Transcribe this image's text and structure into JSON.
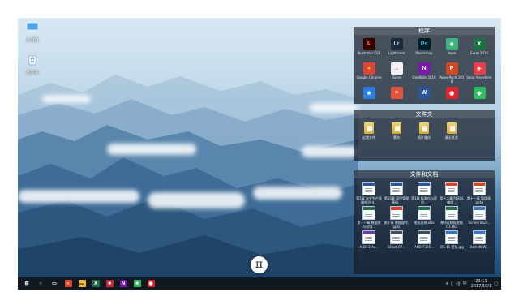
{
  "desktop_icons": [
    {
      "label": "此电脑",
      "icon": "computer-icon"
    },
    {
      "label": "回收站",
      "icon": "recycle-bin-icon"
    }
  ],
  "panels": {
    "programs": {
      "title": "程序",
      "items": [
        {
          "label": "Illustrator CS6",
          "glyph": "Ai",
          "color": "#ff7c00",
          "bg": "#330000"
        },
        {
          "label": "Lightroom",
          "glyph": "Lr",
          "color": "#b9d7f3",
          "bg": "#1c2b3c"
        },
        {
          "label": "Photoshop",
          "glyph": "Ps",
          "color": "#31c5f0",
          "bg": "#001d26"
        },
        {
          "label": "Atom",
          "glyph": "⚛",
          "color": "#ffffff",
          "bg": "#3fb27f"
        },
        {
          "label": "Excel 2016",
          "glyph": "X",
          "color": "#ffffff",
          "bg": "#1e7145"
        },
        {
          "label": "Google Chrome",
          "glyph": "●",
          "color": "#fbc02d",
          "bg": "#db4437"
        },
        {
          "label": "iTunes",
          "glyph": "♫",
          "color": "#e9458b",
          "bg": "#f2f2f2"
        },
        {
          "label": "OneNote 2016",
          "glyph": "N",
          "color": "#ffffff",
          "bg": "#7719aa"
        },
        {
          "label": "PowerPoint 2016",
          "glyph": "P",
          "color": "#ffffff",
          "bg": "#d24726"
        },
        {
          "label": "Send Anywhere",
          "glyph": "✈",
          "color": "#ffffff",
          "bg": "#e83e4c"
        },
        {
          "label": "",
          "glyph": "★",
          "color": "#ffffff",
          "bg": "#2a7de1"
        },
        {
          "label": "",
          "glyph": "≡",
          "color": "#ffffff",
          "bg": "#e5533d"
        },
        {
          "label": "",
          "glyph": "W",
          "color": "#ffffff",
          "bg": "#2b579a"
        },
        {
          "label": "",
          "glyph": "◉",
          "color": "#ffffff",
          "bg": "#e0242b"
        },
        {
          "label": "",
          "glyph": "◆",
          "color": "#ffffff",
          "bg": "#2dbe60"
        }
      ]
    },
    "folders": {
      "title": "文件夹",
      "items": [
        {
          "label": "近期文件"
        },
        {
          "label": "素材"
        },
        {
          "label": "照片备份"
        },
        {
          "label": "最近任务"
        }
      ]
    },
    "documents": {
      "title": "文件和文档",
      "items": [
        {
          "label": "第1章 安全生产基础知识.d...",
          "accent": "#2b579a"
        },
        {
          "label": "第10章 项目管理基础...",
          "accent": "#2b579a"
        },
        {
          "label": "第1章 标准化与项目...",
          "accent": "#2b579a"
        },
        {
          "label": "第十二章 PLSQL编程...",
          "accent": "#d24726"
        },
        {
          "label": "第十一章 管理表.pptx",
          "accent": "#d24726"
        },
        {
          "label": "第十一章 数据库与存储...",
          "accent": "#1e7145"
        },
        {
          "label": "第十章 数据操作.pptx",
          "accent": "#d24726"
        },
        {
          "label": "电影选择.xlsx",
          "accent": "#1e7145"
        },
        {
          "label": "神·6月财报数据(1).xlsx",
          "accent": "#1e7145"
        },
        {
          "label": "ScreenToGif...",
          "accent": "#3a76b8"
        },
        {
          "label": "AU213-As...",
          "accent": "#6a3fa0"
        },
        {
          "label": "Ghost-07...",
          "accent": "#444c58"
        },
        {
          "label": "AKD-7365...",
          "accent": "#444c58"
        },
        {
          "label": "iOS 11 壁纸.jpg",
          "accent": "#3a76b8"
        },
        {
          "label": "Best-4K-W...",
          "accent": "#3a76b8"
        }
      ]
    }
  },
  "taskbar": {
    "apps": [
      {
        "name": "start-button",
        "glyph": "⊞",
        "bg": "transparent",
        "color": "#ffffff"
      },
      {
        "name": "search-icon",
        "glyph": "○",
        "bg": "transparent",
        "color": "#ffffff"
      },
      {
        "name": "task-view-icon",
        "glyph": "▭",
        "bg": "transparent",
        "color": "#ffffff"
      },
      {
        "name": "chrome-taskbar-icon",
        "glyph": "●",
        "bg": "#db4437",
        "color": "#fbc02d"
      },
      {
        "name": "file-explorer-taskbar-icon",
        "glyph": "▬",
        "bg": "#f0c040",
        "color": "#8a6a10"
      },
      {
        "name": "excel-taskbar-icon",
        "glyph": "X",
        "bg": "#1e7145",
        "color": "#ffffff"
      },
      {
        "name": "app-taskbar-icon",
        "glyph": "■",
        "bg": "#c8283a",
        "color": "#ffffff"
      },
      {
        "name": "onenote-taskbar-icon",
        "glyph": "N",
        "bg": "#7719aa",
        "color": "#ffffff"
      },
      {
        "name": "green-app-taskbar-icon",
        "glyph": "■",
        "bg": "#2dbe60",
        "color": "#ffffff"
      },
      {
        "name": "netease-taskbar-icon",
        "glyph": "◉",
        "bg": "#e0242b",
        "color": "#ffffff"
      }
    ],
    "tray_glyphs": [
      "∧",
      "▯",
      "◁)",
      "中"
    ],
    "time": "23:11",
    "date": "2017/10/1"
  },
  "logo_glyph": "π"
}
